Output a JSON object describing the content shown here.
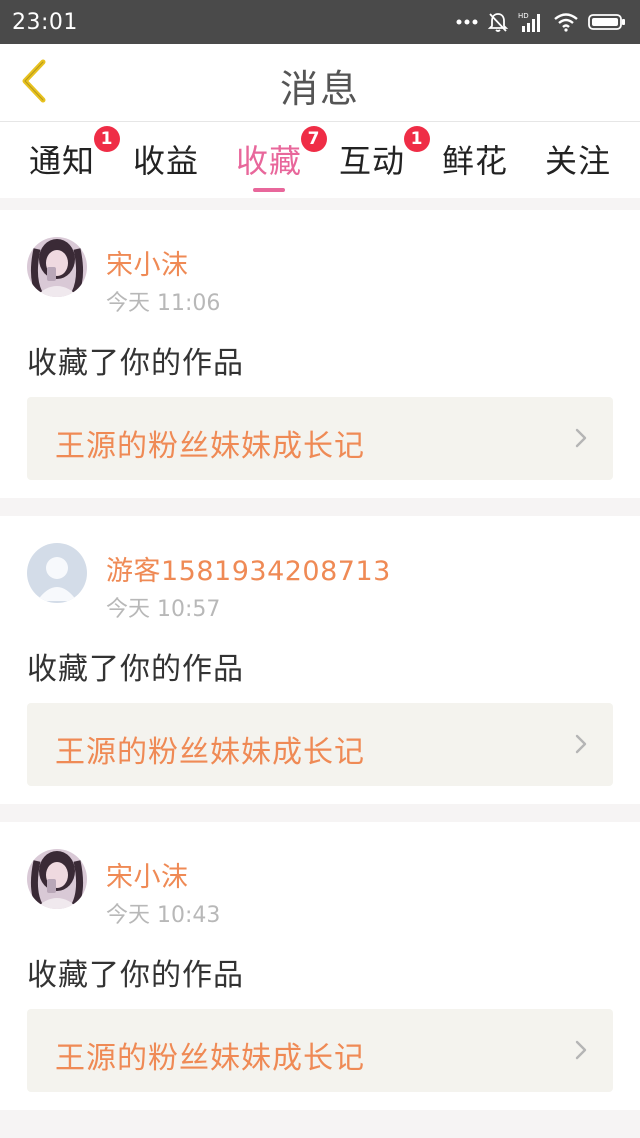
{
  "status_bar": {
    "time": "23:01",
    "icons": [
      "more-dots-icon",
      "mute-bell-icon",
      "signal-icon",
      "wifi-icon",
      "battery-icon"
    ]
  },
  "header": {
    "back_icon": "chevron-left-icon",
    "title": "消息"
  },
  "tabs": [
    {
      "label": "通知",
      "badge": "1"
    },
    {
      "label": "收益",
      "badge": ""
    },
    {
      "label": "收藏",
      "badge": "7",
      "active": true
    },
    {
      "label": "互动",
      "badge": "1"
    },
    {
      "label": "鲜花",
      "badge": ""
    },
    {
      "label": "关注",
      "badge": ""
    }
  ],
  "messages": [
    {
      "user": "宋小沫",
      "time": "今天 11:06",
      "action": "收藏了你的作品",
      "work": "王源的粉丝妹妹成长记",
      "avatar": "photo-avatar"
    },
    {
      "user": "游客1581934208713",
      "time": "今天 10:57",
      "action": "收藏了你的作品",
      "work": "王源的粉丝妹妹成长记",
      "avatar": "default-avatar"
    },
    {
      "user": "宋小沫",
      "time": "今天 10:43",
      "action": "收藏了你的作品",
      "work": "王源的粉丝妹妹成长记",
      "avatar": "photo-avatar"
    }
  ],
  "colors": {
    "accent_pink": "#e8679b",
    "name_orange": "#ef8a55",
    "badge_red": "#ef2d46",
    "back_yellow": "#e8c21f"
  }
}
